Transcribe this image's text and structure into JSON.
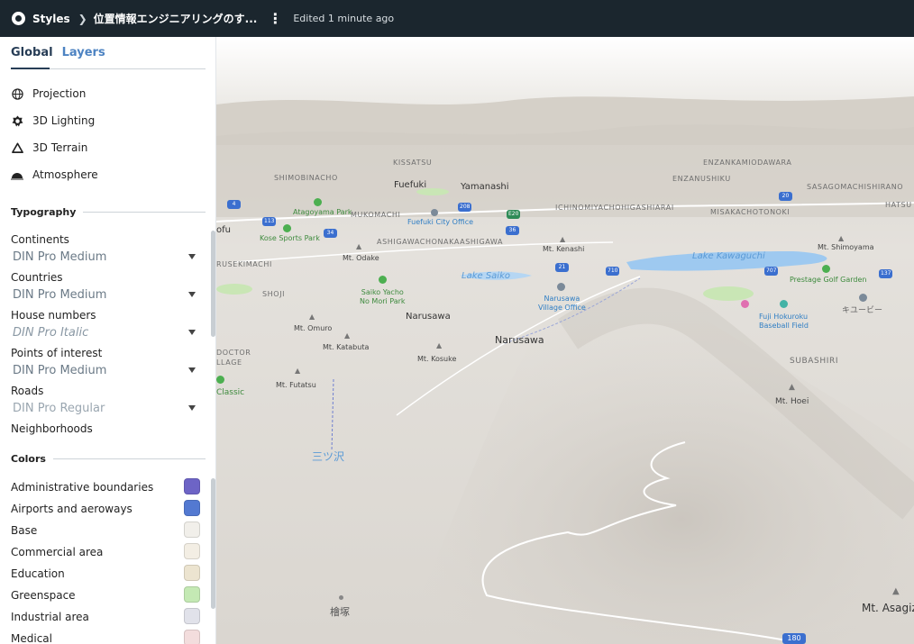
{
  "topbar": {
    "app": "Styles",
    "style_name": "位置情報エンジニアリングのす...",
    "edited": "Edited 1 minute ago"
  },
  "tabs": {
    "global": "Global",
    "layers": "Layers"
  },
  "global_items": [
    {
      "label": "Projection",
      "icon": "globe-icon"
    },
    {
      "label": "3D Lighting",
      "icon": "lighting-icon"
    },
    {
      "label": "3D Terrain",
      "icon": "terrain-icon"
    },
    {
      "label": "Atmosphere",
      "icon": "atmosphere-icon"
    }
  ],
  "typography": {
    "heading": "Typography",
    "rows": [
      {
        "label": "Continents",
        "value": "DIN Pro Medium"
      },
      {
        "label": "Countries",
        "value": "DIN Pro Medium"
      },
      {
        "label": "House numbers",
        "value": "DIN Pro Italic"
      },
      {
        "label": "Points of interest",
        "value": "DIN Pro Medium"
      },
      {
        "label": "Roads",
        "value": "DIN Pro Regular"
      }
    ],
    "last": "Neighborhoods"
  },
  "colors": {
    "heading": "Colors",
    "rows": [
      {
        "label": "Administrative boundaries",
        "color": "#6d64c6"
      },
      {
        "label": "Airports and aeroways",
        "color": "#5379d1"
      },
      {
        "label": "Base",
        "color": "#f1efea"
      },
      {
        "label": "Commercial area",
        "color": "#f3eee4"
      },
      {
        "label": "Education",
        "color": "#ece4d0"
      },
      {
        "label": "Greenspace",
        "color": "#c4e9b4"
      },
      {
        "label": "Industrial area",
        "color": "#e1e2ea"
      },
      {
        "label": "Medical",
        "color": "#f3dddd"
      }
    ]
  },
  "map": {
    "labels": {
      "kissatsu": "KISSATSU",
      "enzankamiodawara": "ENZANKAMIODAWARA",
      "shimobinacho": "SHIMOBINACHO",
      "enzanushiku": "ENZANUSHIKU",
      "fuefuki": "Fuefuki",
      "yamanashi": "Yamanashi",
      "sasagomachi": "SASAGOMACHISHIRANO",
      "atagoyama": "Atagoyama Park",
      "mukomachi": "MUKOMACHI",
      "ichinomiya": "ICHINOMIYACHOHIGASHIARAI",
      "misakacho": "MISAKACHOTONOKI",
      "hatsu": "HATSU",
      "kofu": "ofu",
      "fuefuki_office": "Fuefuki City Office",
      "kose": "Kose Sports Park",
      "ashigawa": "ASHIGAWACHONAKAASHIGAWA",
      "kenashi": "Mt. Kenashi",
      "shimoyama": "Mt. Shimoyama",
      "rusekimachi": "RUSEKIMACHI",
      "odake": "Mt. Odake",
      "lake_kawaguchi": "Lake Kawaguchi",
      "lake_saiko": "Lake Saiko",
      "prestage": "Prestage Golf Garden",
      "shoji": "SHOJI",
      "saiko_yacho": "Saiko Yacho\nNo Mori Park",
      "narusawa_office": "Narusawa\nVillage Office",
      "qubi": "キユービー",
      "fuji_baseball": "Fuji Hokuroku\nBaseball Field",
      "omuro": "Mt. Omuro",
      "narusawa1": "Narusawa",
      "narusawa2": "Narusawa",
      "katabuta": "Mt. Katabuta",
      "kosuke": "Mt. Kosuke",
      "doctor": "DOCTOR\nLLAGE",
      "subashiri": "SUBASHIRI",
      "futatsu": "Mt. Futatsu",
      "classic": "Classic",
      "hoei": "Mt. Hoei",
      "mitsusawa": "三ツ沢",
      "hinokizuka": "檜塚",
      "asagiri": "Mt. Asagiz",
      "road_180": "180",
      "shields": [
        "4",
        "113",
        "34",
        "208",
        "E20",
        "36",
        "21",
        "710",
        "707",
        "137",
        "20"
      ]
    }
  }
}
